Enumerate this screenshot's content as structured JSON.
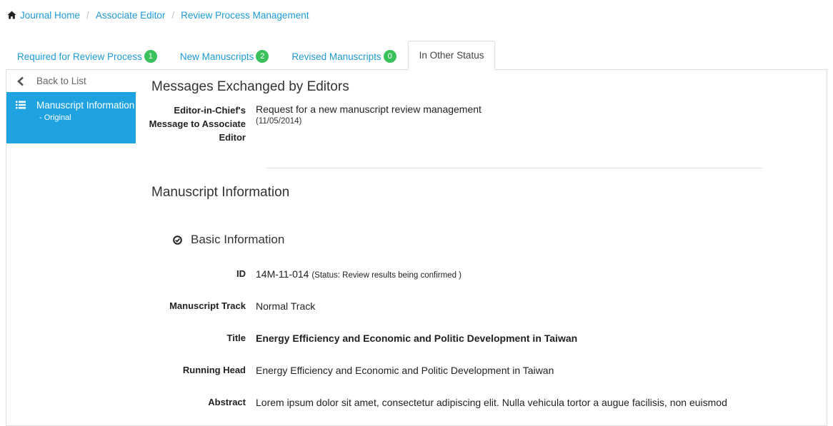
{
  "breadcrumb": {
    "home_icon": "home-icon",
    "items": [
      "Journal Home",
      "Associate Editor",
      "Review Process Management"
    ],
    "separator": "/"
  },
  "tabs": [
    {
      "label": "Required for Review Process",
      "badge": "1"
    },
    {
      "label": "New Manuscripts",
      "badge": "2"
    },
    {
      "label": "Revised Manuscripts",
      "badge": "0"
    },
    {
      "label": "In Other Status",
      "badge": null,
      "active": true
    }
  ],
  "colors": {
    "link": "#1e9bd7",
    "sidebar_active": "#1fa3e0",
    "badge": "#3bc15c"
  },
  "sidebar": {
    "back_label": "Back to List",
    "item": {
      "label": "Manuscript Information",
      "sub": "- Original",
      "icon": "list-icon"
    }
  },
  "messages": {
    "title": "Messages Exchanged by Editors",
    "label": "Editor-in-Chief's Message to Associate Editor",
    "text": "Request for a new manuscript review management",
    "date": "(11/05/2014)"
  },
  "manuscript": {
    "title": "Manuscript Information",
    "section": "Basic Information",
    "fields": {
      "id_label": "ID",
      "id_value": "14M-11-014",
      "status": "(Status: Review results being confirmed )",
      "track_label": "Manuscript Track",
      "track_value": "Normal Track",
      "title_label": "Title",
      "title_value": "Energy Efficiency and Economic and Politic Development in Taiwan",
      "running_head_label": "Running Head",
      "running_head_value": "Energy Efficiency and Economic and Politic Development in Taiwan",
      "abstract_label": "Abstract",
      "abstract_value": "Lorem ipsum dolor sit amet, consectetur adipiscing elit. Nulla vehicula tortor a augue facilisis, non euismod"
    }
  }
}
